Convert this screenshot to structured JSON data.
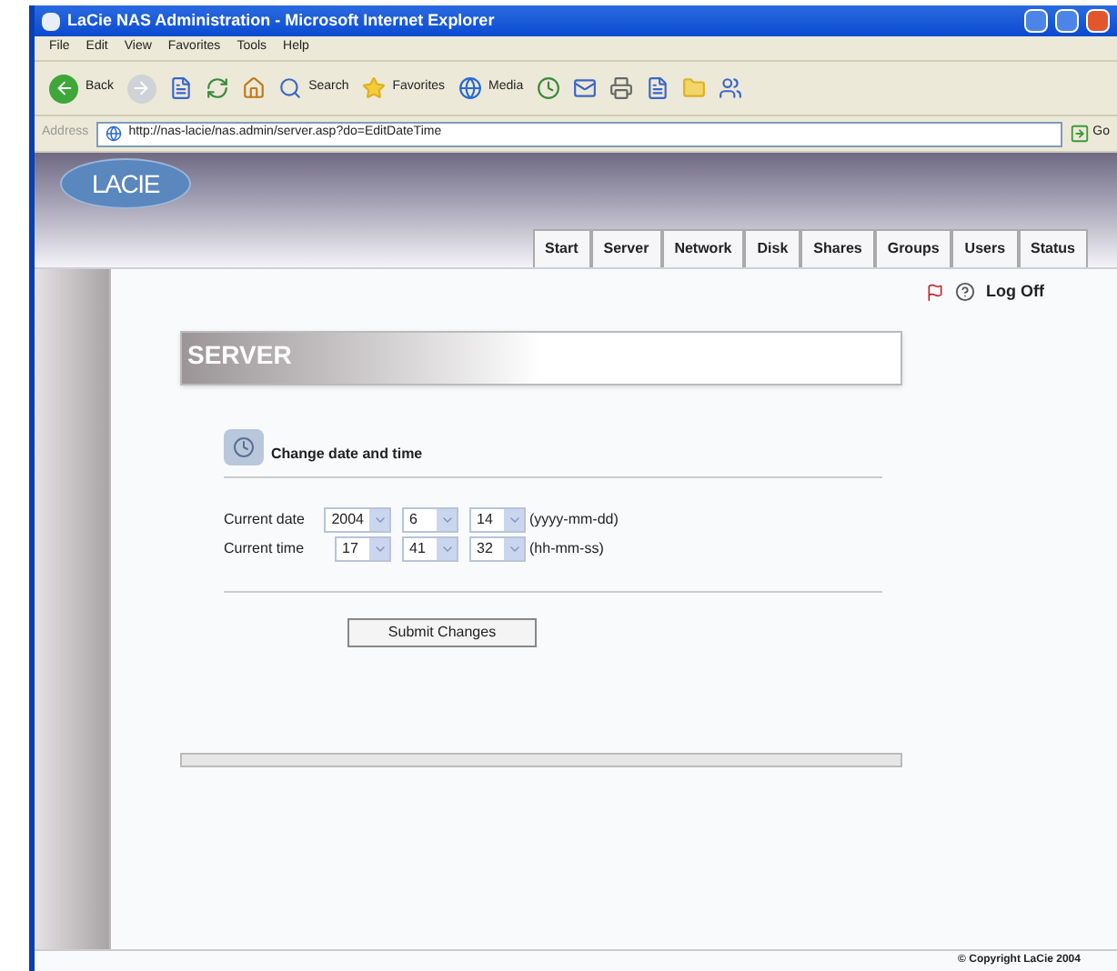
{
  "window": {
    "title": "LaCie NAS Administration - Microsoft Internet Explorer"
  },
  "menu": [
    "File",
    "Edit",
    "View",
    "Favorites",
    "Tools",
    "Help"
  ],
  "toolbar": {
    "back": "Back",
    "search": "Search",
    "favorites": "Favorites",
    "media": "Media"
  },
  "address": {
    "label": "Address",
    "value": "http://nas-lacie/nas.admin/server.asp?do=EditDateTime",
    "go": "Go"
  },
  "logo": "LACIE",
  "tabs": [
    "Start",
    "Server",
    "Network",
    "Disk",
    "Shares",
    "Groups",
    "Users",
    "Status"
  ],
  "logoff": "Log Off",
  "section_title": "SERVER",
  "panel": {
    "heading": "Change date and time",
    "rows": [
      {
        "label": "Current date",
        "fields": [
          "2004",
          "6",
          "14"
        ],
        "format": "(yyyy-mm-dd)"
      },
      {
        "label": "Current time",
        "fields": [
          "17",
          "41",
          "32"
        ],
        "format": "(hh-mm-ss)"
      }
    ],
    "submit": "Submit Changes"
  },
  "footer": "© Copyright LaCie 2004"
}
